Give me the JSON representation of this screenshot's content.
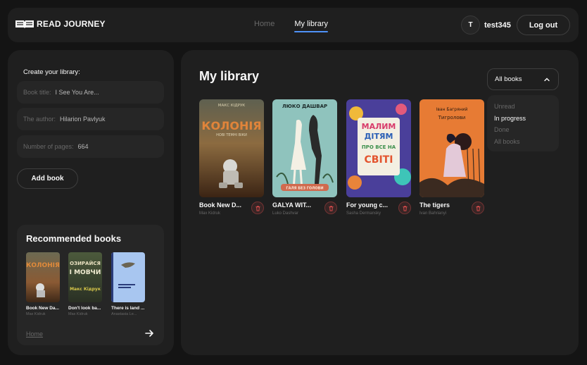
{
  "header": {
    "logo_text": "READ JOURNEY",
    "nav": [
      {
        "label": "Home",
        "active": false
      },
      {
        "label": "My library",
        "active": true
      }
    ],
    "user": {
      "initial": "T",
      "name": "test345"
    },
    "logout_label": "Log out"
  },
  "form": {
    "title": "Create your library:",
    "fields": [
      {
        "label": "Book title:",
        "value": "I See You Are..."
      },
      {
        "label": "The author:",
        "value": "Hilarion Pavlyuk"
      },
      {
        "label": "Number of pages:",
        "value": "664"
      }
    ],
    "add_label": "Add book"
  },
  "recommended": {
    "title": "Recommended books",
    "books": [
      {
        "title": "Book New Da...",
        "author": "Max Kidruk"
      },
      {
        "title": "Don't look ba...",
        "author": "Max Kidruk"
      },
      {
        "title": "There is land ...",
        "author": "Anastasia Le..."
      }
    ],
    "home_link": "Home"
  },
  "library": {
    "title": "My library",
    "filter": {
      "selected": "All books",
      "options": [
        "Unread",
        "In progress",
        "Done",
        "All books"
      ],
      "highlighted": "In progress"
    },
    "books": [
      {
        "title": "Book New D...",
        "author": "Max Kidruk"
      },
      {
        "title": "GALYA WIT...",
        "author": "Luko Dashvar"
      },
      {
        "title": "For young c...",
        "author": "Sasha Dermansky"
      },
      {
        "title": "The tigers",
        "author": "Ivan Bahrianyi"
      }
    ]
  },
  "covers": {
    "kolonia": {
      "top": "МАКС КІДРУК",
      "title": "КОЛОНІЯ",
      "sub": "НОВІ ТЕМНІ ВІКИ"
    },
    "galya": {
      "top": "ЛЮКО ДАШВАР",
      "title": "ГАЛЯ БЕЗ ГОЛОВИ"
    },
    "malym": {
      "title1": "МАЛИМ",
      "title2": "ДІТЯМ",
      "title3": "ПРО ВСЕ НА",
      "title4": "СВІТІ"
    },
    "tigers": {
      "top": "Іван Багряний",
      "title": "Тигролови"
    },
    "rec2": {
      "title1": "НЕ",
      "title2": "ОЗИРАЙСЯ",
      "title3": "І МОВЧИ",
      "author": "Макс Кідрук"
    }
  },
  "colors": {
    "accent": "#4f92f7",
    "danger": "#e85050",
    "panel": "#1f1f1f",
    "field": "#262626"
  }
}
